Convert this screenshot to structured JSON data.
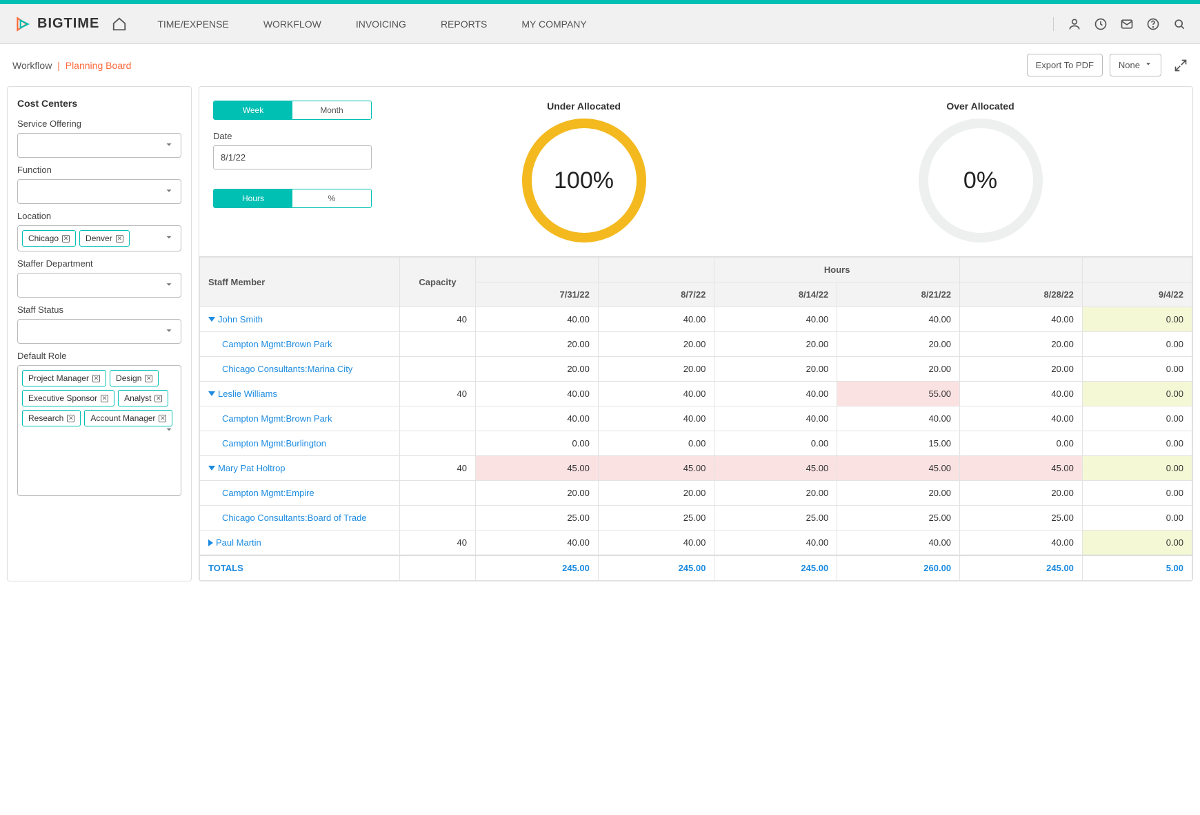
{
  "brand": "BIGTIME",
  "nav": {
    "items": [
      "TIME/EXPENSE",
      "WORKFLOW",
      "INVOICING",
      "REPORTS",
      "MY COMPANY"
    ]
  },
  "breadcrumb": {
    "root": "Workflow",
    "sep": "|",
    "active": "Planning Board"
  },
  "actions": {
    "export": "Export To PDF",
    "dropdown": "None"
  },
  "sidebar": {
    "title": "Cost Centers",
    "fields": {
      "service": "Service Offering",
      "function": "Function",
      "location": "Location",
      "dept": "Staffer Department",
      "status": "Staff Status",
      "role": "Default Role"
    },
    "location_chips": [
      "Chicago",
      "Denver"
    ],
    "role_chips": [
      "Project Manager",
      "Design",
      "Executive Sponsor",
      "Analyst",
      "Research",
      "Account Manager"
    ]
  },
  "controls": {
    "period": {
      "a": "Week",
      "b": "Month"
    },
    "date_label": "Date",
    "date_value": "8/1/22",
    "unit": {
      "a": "Hours",
      "b": "%"
    }
  },
  "gauges": {
    "under": {
      "title": "Under Allocated",
      "value": "100%"
    },
    "over": {
      "title": "Over Allocated",
      "value": "0%"
    }
  },
  "chart_data": {
    "type": "table",
    "title": "Staff allocation (hours) by week",
    "categories": [
      "7/31/22",
      "8/7/22",
      "8/14/22",
      "8/21/22",
      "8/28/22",
      "9/4/22"
    ],
    "series": [
      {
        "name": "John Smith",
        "capacity": 40,
        "values": [
          40.0,
          40.0,
          40.0,
          40.0,
          40.0,
          0.0
        ]
      },
      {
        "name": "Leslie Williams",
        "capacity": 40,
        "values": [
          40.0,
          40.0,
          40.0,
          55.0,
          40.0,
          0.0
        ]
      },
      {
        "name": "Mary Pat Holtrop",
        "capacity": 40,
        "values": [
          45.0,
          45.0,
          45.0,
          45.0,
          45.0,
          0.0
        ]
      },
      {
        "name": "Paul Martin",
        "capacity": 40,
        "values": [
          40.0,
          40.0,
          40.0,
          40.0,
          40.0,
          0.0
        ]
      }
    ],
    "totals": [
      245.0,
      245.0,
      245.0,
      260.0,
      245.0,
      5.0
    ]
  },
  "table": {
    "header": {
      "staff": "Staff Member",
      "capacity": "Capacity",
      "group": "Hours",
      "dates": [
        "7/31/22",
        "8/7/22",
        "8/14/22",
        "8/21/22",
        "8/28/22",
        "9/4/22"
      ]
    },
    "totals_label": "TOTALS",
    "totals": [
      "245.00",
      "245.00",
      "245.00",
      "260.00",
      "245.00",
      "5.00"
    ],
    "rows": [
      {
        "type": "staff",
        "expand": "down",
        "name": "John Smith",
        "cap": "40",
        "cells": [
          {
            "v": "40.00"
          },
          {
            "v": "40.00"
          },
          {
            "v": "40.00"
          },
          {
            "v": "40.00"
          },
          {
            "v": "40.00"
          },
          {
            "v": "0.00",
            "hl": "yel"
          }
        ]
      },
      {
        "type": "proj",
        "name": "Campton Mgmt:Brown Park",
        "cells": [
          {
            "v": "20.00"
          },
          {
            "v": "20.00"
          },
          {
            "v": "20.00"
          },
          {
            "v": "20.00"
          },
          {
            "v": "20.00"
          },
          {
            "v": "0.00"
          }
        ]
      },
      {
        "type": "proj",
        "name": "Chicago Consultants:Marina City",
        "cells": [
          {
            "v": "20.00"
          },
          {
            "v": "20.00"
          },
          {
            "v": "20.00"
          },
          {
            "v": "20.00"
          },
          {
            "v": "20.00"
          },
          {
            "v": "0.00"
          }
        ]
      },
      {
        "type": "staff",
        "expand": "down",
        "name": "Leslie Williams",
        "cap": "40",
        "cells": [
          {
            "v": "40.00"
          },
          {
            "v": "40.00"
          },
          {
            "v": "40.00"
          },
          {
            "v": "55.00",
            "hl": "red"
          },
          {
            "v": "40.00"
          },
          {
            "v": "0.00",
            "hl": "yel"
          }
        ]
      },
      {
        "type": "proj",
        "name": "Campton Mgmt:Brown Park",
        "cells": [
          {
            "v": "40.00"
          },
          {
            "v": "40.00"
          },
          {
            "v": "40.00"
          },
          {
            "v": "40.00"
          },
          {
            "v": "40.00"
          },
          {
            "v": "0.00"
          }
        ]
      },
      {
        "type": "proj",
        "name": "Campton Mgmt:Burlington",
        "cells": [
          {
            "v": "0.00"
          },
          {
            "v": "0.00"
          },
          {
            "v": "0.00"
          },
          {
            "v": "15.00"
          },
          {
            "v": "0.00"
          },
          {
            "v": "0.00"
          }
        ]
      },
      {
        "type": "staff",
        "expand": "down",
        "name": "Mary Pat Holtrop",
        "cap": "40",
        "cells": [
          {
            "v": "45.00",
            "hl": "red"
          },
          {
            "v": "45.00",
            "hl": "red"
          },
          {
            "v": "45.00",
            "hl": "red"
          },
          {
            "v": "45.00",
            "hl": "red"
          },
          {
            "v": "45.00",
            "hl": "red"
          },
          {
            "v": "0.00",
            "hl": "yel"
          }
        ]
      },
      {
        "type": "proj",
        "name": "Campton Mgmt:Empire",
        "cells": [
          {
            "v": "20.00"
          },
          {
            "v": "20.00"
          },
          {
            "v": "20.00"
          },
          {
            "v": "20.00"
          },
          {
            "v": "20.00"
          },
          {
            "v": "0.00"
          }
        ]
      },
      {
        "type": "proj",
        "name": "Chicago Consultants:Board of Trade",
        "cells": [
          {
            "v": "25.00"
          },
          {
            "v": "25.00"
          },
          {
            "v": "25.00"
          },
          {
            "v": "25.00"
          },
          {
            "v": "25.00"
          },
          {
            "v": "0.00"
          }
        ]
      },
      {
        "type": "staff",
        "expand": "right",
        "name": "Paul Martin",
        "cap": "40",
        "cells": [
          {
            "v": "40.00"
          },
          {
            "v": "40.00"
          },
          {
            "v": "40.00"
          },
          {
            "v": "40.00"
          },
          {
            "v": "40.00"
          },
          {
            "v": "0.00",
            "hl": "yel"
          }
        ]
      }
    ]
  }
}
